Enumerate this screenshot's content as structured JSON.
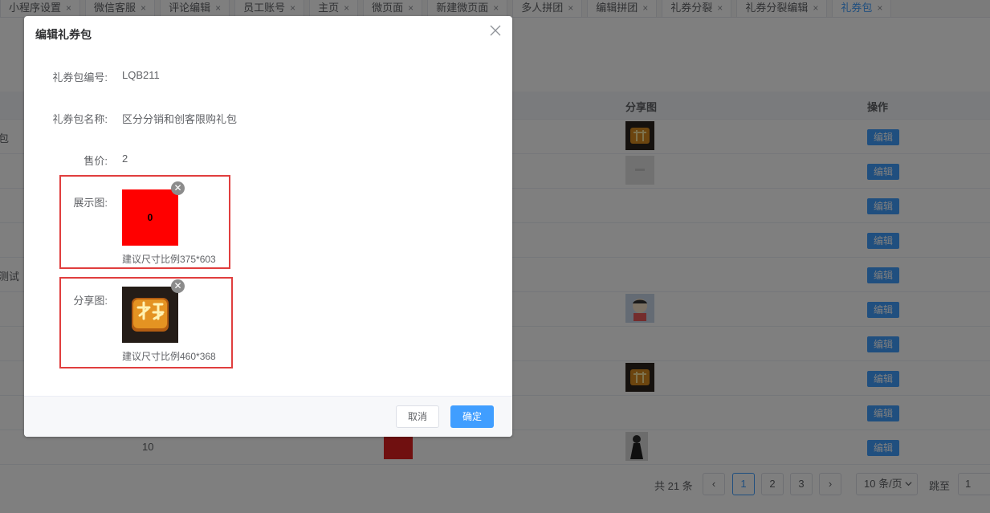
{
  "tabs": [
    {
      "label": "小程序设置"
    },
    {
      "label": "微信客服"
    },
    {
      "label": "评论编辑"
    },
    {
      "label": "员工账号"
    },
    {
      "label": "主页"
    },
    {
      "label": "微页面"
    },
    {
      "label": "新建微页面"
    },
    {
      "label": "多人拼团"
    },
    {
      "label": "编辑拼团"
    },
    {
      "label": "礼券分裂"
    },
    {
      "label": "礼券分裂编辑"
    },
    {
      "label": "礼券包"
    }
  ],
  "tab_close_glyph": "×",
  "table": {
    "headers": {
      "share_image": "分享图",
      "actions": "操作"
    },
    "edit_label": "编辑",
    "rows": [
      {
        "name": "包",
        "price": ""
      },
      {
        "name": "",
        "price": ""
      },
      {
        "name": "",
        "price": ""
      },
      {
        "name": "",
        "price": ""
      },
      {
        "name": "测试",
        "price": ""
      },
      {
        "name": "",
        "price": ""
      },
      {
        "name": "",
        "price": ""
      },
      {
        "name": "",
        "price": ""
      },
      {
        "name": "",
        "price": ""
      },
      {
        "name": "",
        "price": "10"
      }
    ]
  },
  "pagination": {
    "total": "共 21 条",
    "prev": "‹",
    "next": "›",
    "pages": [
      "1",
      "2",
      "3"
    ],
    "current_page": "1",
    "page_size": "10 条/页",
    "jump_label": "跳至",
    "jump_value": "1"
  },
  "dialog": {
    "title": "编辑礼券包",
    "fields": {
      "code_label": "礼券包编号:",
      "code_value": "LQB211",
      "name_label": "礼券包名称:",
      "name_value": "区分分销和创客限购礼包",
      "price_label": "售价:",
      "price_value": "2",
      "display_image_label": "展示图:",
      "display_image_text": "0",
      "display_image_hint": "建议尺寸比例375*603",
      "share_image_label": "分享图:",
      "share_image_hint": "建议尺寸比例460*368"
    },
    "cancel_label": "取消",
    "confirm_label": "确定"
  },
  "colors": {
    "primary": "#409eff",
    "highlight": "#e03e3e",
    "display_image_bg": "#ff0000"
  }
}
